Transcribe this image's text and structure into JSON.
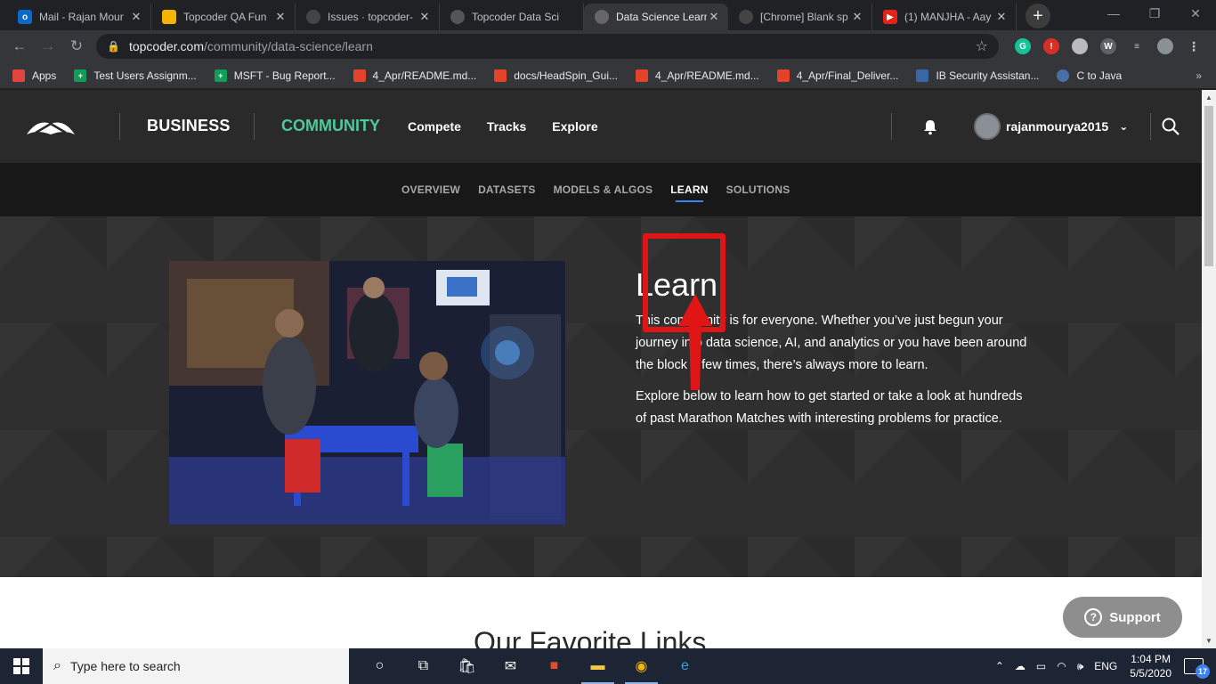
{
  "browser": {
    "tabs": [
      {
        "title": "Mail - Rajan Mour",
        "icon": "outlook-icon",
        "color": "#0a6ac8"
      },
      {
        "title": "Topcoder QA Fun",
        "icon": "slides-icon",
        "color": "#f4b400"
      },
      {
        "title": "Issues · topcoder-",
        "icon": "github-icon",
        "color": "#444"
      },
      {
        "title": "Topcoder Data Sci",
        "icon": "topcoder-icon",
        "color": "#555"
      },
      {
        "title": "Data Science Learn",
        "icon": "globe-icon",
        "color": "#666",
        "active": true
      },
      {
        "title": "[Chrome] Blank sp",
        "icon": "github-icon",
        "color": "#444"
      },
      {
        "title": "(1) MANJHA - Aay",
        "icon": "youtube-icon",
        "color": "#e62117"
      }
    ],
    "url_host": "topcoder.com",
    "url_path": "/community/data-science/learn",
    "bookmarks": [
      {
        "label": "Apps",
        "icon": "apps-grid-icon",
        "color": "#e0443e"
      },
      {
        "label": "Test Users Assignm...",
        "icon": "sheets-icon",
        "color": "#0f9d58"
      },
      {
        "label": "MSFT - Bug Report...",
        "icon": "sheets-icon",
        "color": "#0f9d58"
      },
      {
        "label": "4_Apr/README.md...",
        "icon": "gitlab-icon",
        "color": "#e24329"
      },
      {
        "label": "docs/HeadSpin_Gui...",
        "icon": "gitlab-icon",
        "color": "#e24329"
      },
      {
        "label": "4_Apr/README.md...",
        "icon": "gitlab-icon",
        "color": "#e24329"
      },
      {
        "label": "4_Apr/Final_Deliver...",
        "icon": "gitlab-icon",
        "color": "#e24329"
      },
      {
        "label": "IB Security Assistan...",
        "icon": "ib-icon",
        "color": "#3a66a8"
      },
      {
        "label": "C to Java",
        "icon": "globe-icon",
        "color": "#4a6ea8"
      }
    ]
  },
  "site": {
    "business": "BUSINESS",
    "community": "COMMUNITY",
    "nav": [
      "Compete",
      "Tracks",
      "Explore"
    ],
    "username": "rajanmourya2015",
    "subnav": [
      "OVERVIEW",
      "DATASETS",
      "MODELS & ALGOS",
      "LEARN",
      "SOLUTIONS"
    ],
    "subnav_active": "LEARN",
    "accent_color": "#4ec99a"
  },
  "hero": {
    "title": "Learn",
    "paragraph1": "This community is for everyone. Whether you’ve just begun your journey into data science, AI, and analytics or you have been around the block a few times, there’s always more to learn.",
    "paragraph2": "Explore below to learn how to get started or take a look at hundreds of past Marathon Matches with interesting problems for practice."
  },
  "section": {
    "heading": "Our Favorite Links"
  },
  "support_label": "Support",
  "taskbar": {
    "search_placeholder": "Type here to search",
    "language": "ENG",
    "time": "1:04 PM",
    "date": "5/5/2020",
    "notifications": "17"
  }
}
